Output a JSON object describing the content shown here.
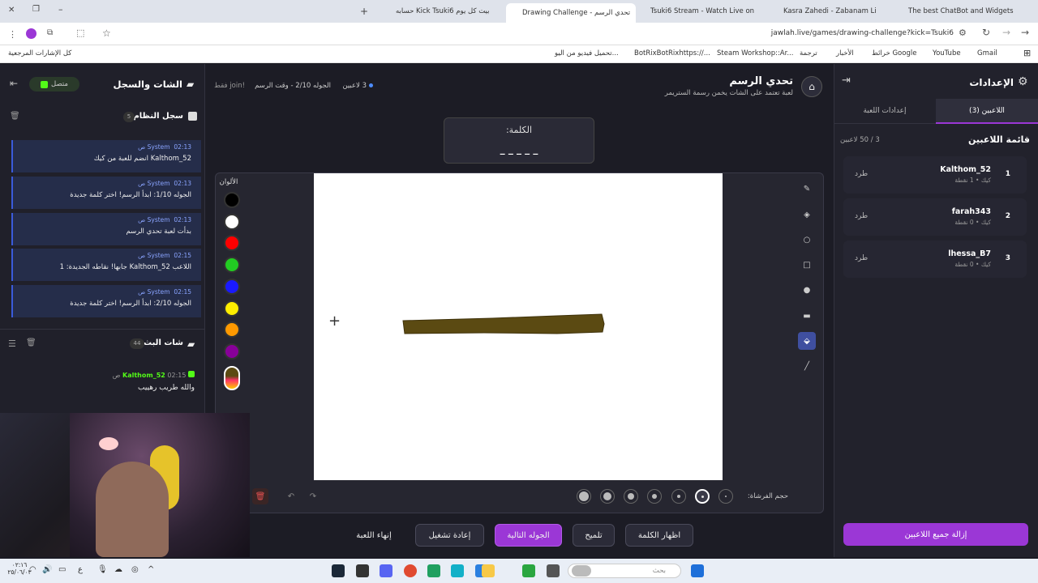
{
  "browser": {
    "tabs": [
      {
        "label": "The best ChatBot and Widgets",
        "active": false
      },
      {
        "label": "Kasra Zahedi - Zabanam Li",
        "active": false
      },
      {
        "label": "Tsuki6 Stream - Watch Live on",
        "active": false
      },
      {
        "label": "Drawing Challenge - تحدي الرسم",
        "active": true
      },
      {
        "label": "حسابه Kick Tsuki6 بيت كل يوم",
        "active": false
      }
    ],
    "url": "jawlah.live/games/drawing-challenge?kick=Tsuki6",
    "bookmarks": [
      "Gmail",
      "YouTube",
      "خرائط Google",
      "الأخبار",
      "ترجمة",
      "Steam Workshop::Ar...",
      "BotRixBotRixhttps://...",
      "تحميل فيديو من اليو...",
      "كل الإشارات المرجعية"
    ]
  },
  "settings": {
    "title": "الإعدادات",
    "tab_players": "اللاعبين (3)",
    "tab_game": "إعدادات اللعبة",
    "players_list_title": "قائمة اللاعبين",
    "players_count": "3 / 50 لاعبين",
    "kick_label": "طرد",
    "players": [
      {
        "rank": "1",
        "name": "Kalthom_52",
        "sub": "كيك • 1 نقطة"
      },
      {
        "rank": "2",
        "name": "farah343",
        "sub": "كيك • 0 نقطة"
      },
      {
        "rank": "3",
        "name": "lhessa_B7",
        "sub": "كيك • 0 نقطة"
      }
    ],
    "remove_all": "إزالة جميع اللاعبين"
  },
  "header": {
    "title": "تحدي الرسم",
    "subtitle": "لعبة تعتمد على الشات يخمن رسمة الستريمر",
    "players_badge": "3 لاعبين",
    "round_info": "الجوله 2/10 - وقت الرسم",
    "join_info": "!join فقط"
  },
  "word": {
    "label": "الكلمة:",
    "mask": "_ _ _ _ _"
  },
  "colors": {
    "title": "الألوان",
    "list": [
      "#000000",
      "#ffffff",
      "#ff0000",
      "#22cc22",
      "#1a1aff",
      "#ffee00",
      "#ff9900",
      "#880099"
    ],
    "stroke": "#5b4a12"
  },
  "brush": {
    "label": "حجم الفرشاة:"
  },
  "buttons": {
    "show_word": "اظهار الكلمة",
    "hint": "تلميح",
    "next_round": "الجوله التالية",
    "restart": "إعادة تشغيل",
    "end_game": "إنهاء اللعبة"
  },
  "chat": {
    "title": "الشات والسجل",
    "status": "متصل",
    "system_log_title": "سجل النظام",
    "system_log_count": "5",
    "system_messages": [
      {
        "author": "System",
        "time": "02:13 ص",
        "text": "Kalthom_52 انضم للعبة من كيك"
      },
      {
        "author": "System",
        "time": "02:13 ص",
        "text": "الجوله 1/10: ابدأ الرسم! اختر كلمة جديدة"
      },
      {
        "author": "System",
        "time": "02:13 ص",
        "text": "بدأت لعبة تحدي الرسم"
      },
      {
        "author": "System",
        "time": "02:15 ص",
        "text": "اللاعب Kalthom_52 جابها! نقاطه الجديدة: 1"
      },
      {
        "author": "System",
        "time": "02:15 ص",
        "text": "الجوله 2/10: ابدأ الرسم! اختر كلمة جديدة"
      }
    ],
    "live_chat_title": "شات البث",
    "live_chat_count": "44",
    "live_messages": [
      {
        "author": "Kalthom_52",
        "time": "02:15 ص",
        "text": "والله طريب رهييب"
      }
    ]
  },
  "taskbar": {
    "search": "بحث",
    "time": "٠٢:١٦",
    "date": "٢٥/٠٦/٠٣"
  }
}
